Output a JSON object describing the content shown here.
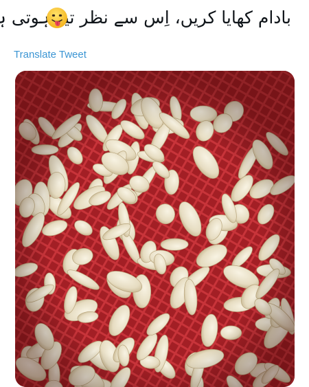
{
  "tweet": {
    "text": "بادام کھایا کریں، اِس سے نظر تیز ہوتی ہے",
    "emoji": "face-with-tongue",
    "translate_label": "Translate Tweet",
    "link_color": "#3b95d3",
    "text_color": "#0f1419"
  },
  "media": {
    "content": "photo of peeled garlic cloves in a red plastic basket",
    "basket_color": "#b5262b",
    "clove_color": "#ece4cf"
  }
}
